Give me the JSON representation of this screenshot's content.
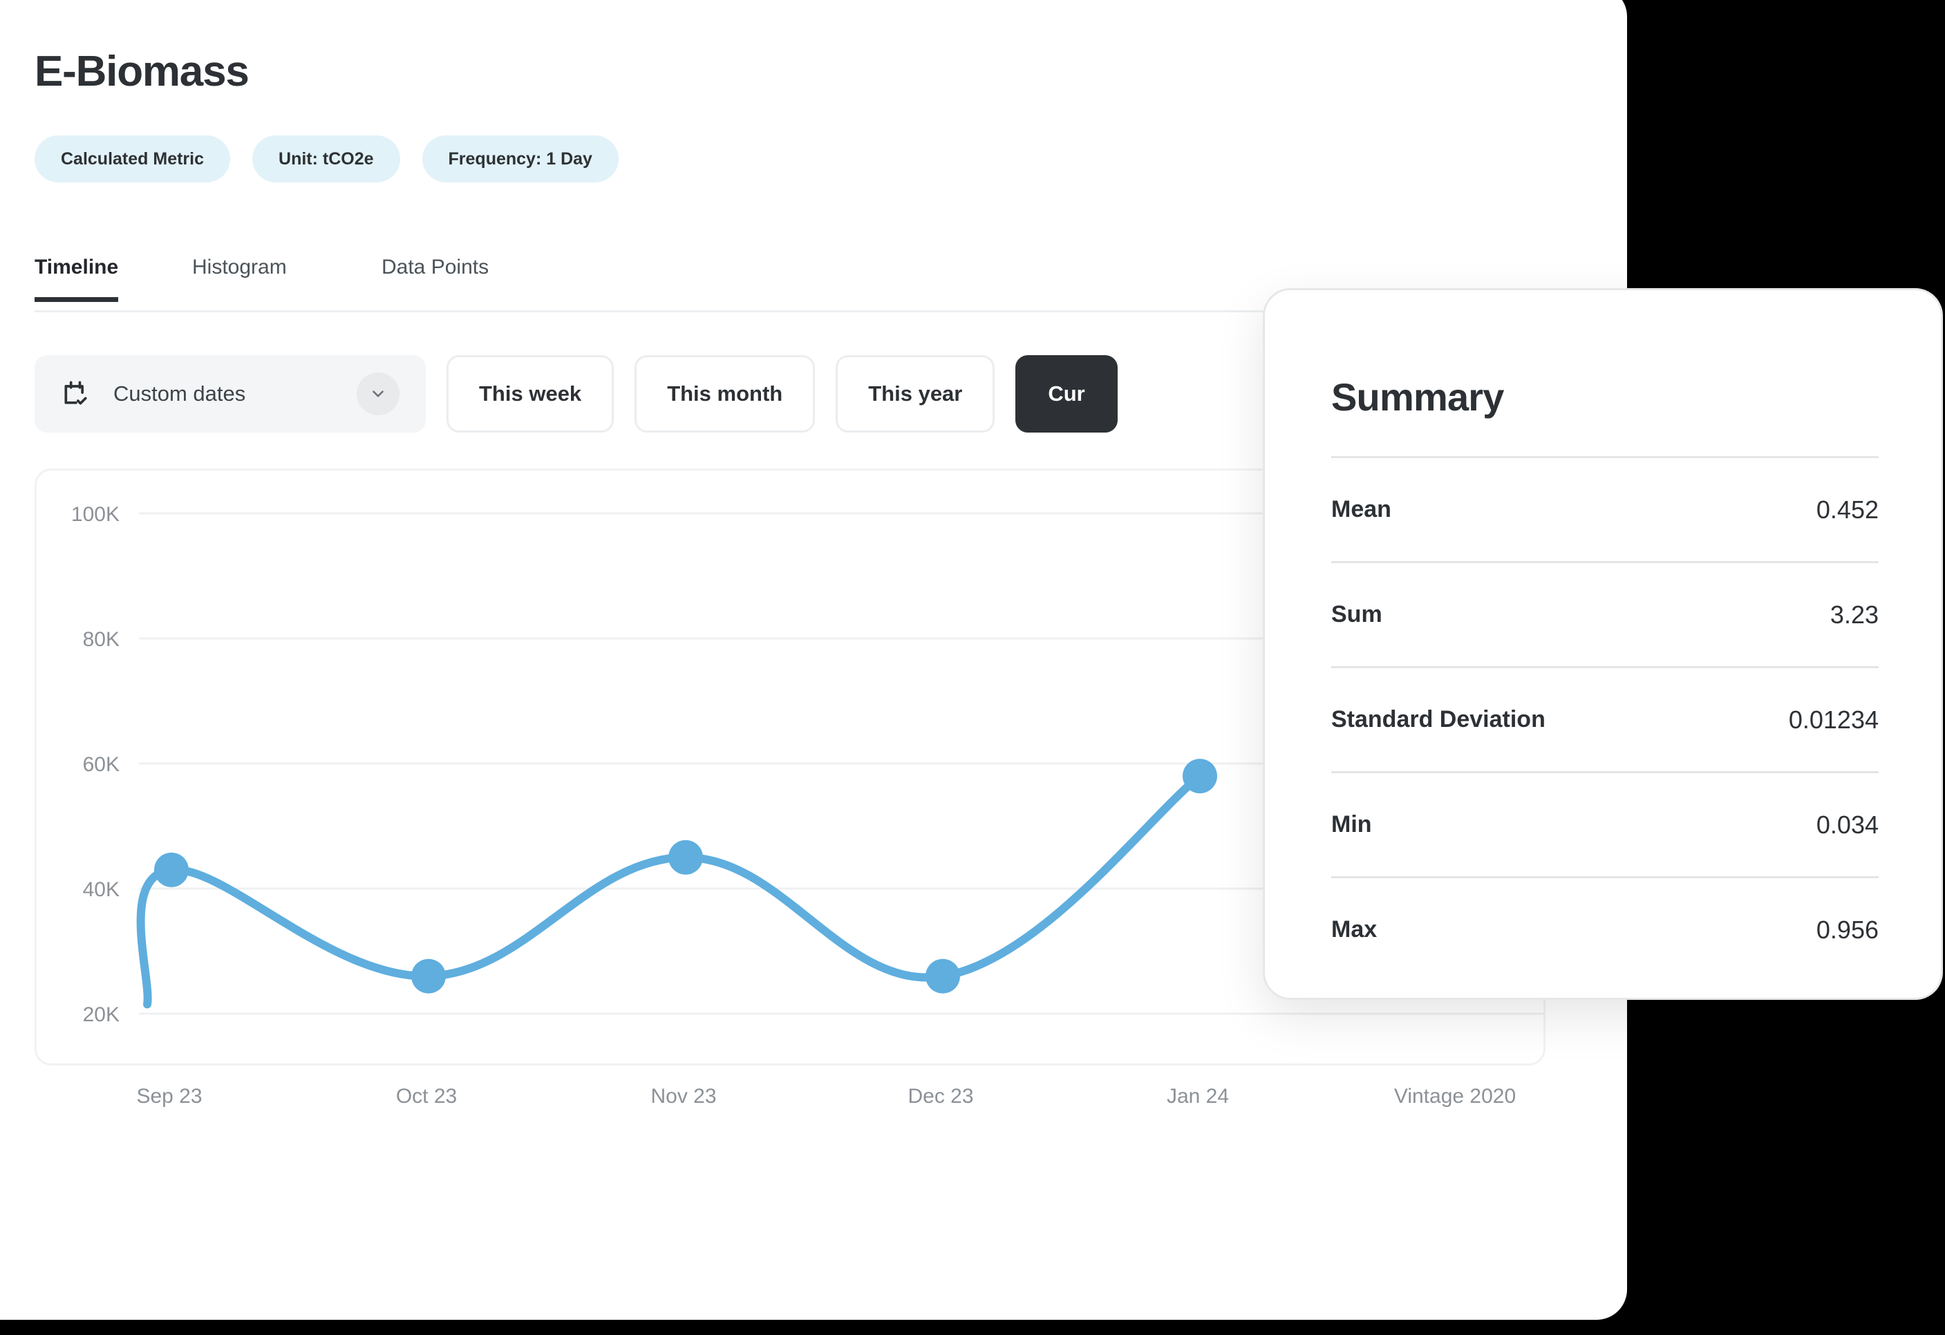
{
  "header": {
    "title": "E-Biomass",
    "badges": [
      {
        "label": "Calculated Metric"
      },
      {
        "label": "Unit: tCO2e"
      },
      {
        "label": "Frequency: 1 Day"
      }
    ]
  },
  "tabs": [
    {
      "label": "Timeline",
      "active": true
    },
    {
      "label": "Histogram",
      "active": false
    },
    {
      "label": "Data Points",
      "active": false
    }
  ],
  "toolbar": {
    "custom_dates_label": "Custom dates",
    "calendar_icon": "calendar-check-icon",
    "chevron_icon": "chevron-down-icon",
    "range_buttons": [
      {
        "label": "This week",
        "active": false
      },
      {
        "label": "This month",
        "active": false
      },
      {
        "label": "This year",
        "active": false
      },
      {
        "label": "Cur",
        "active": true
      }
    ]
  },
  "summary": {
    "title": "Summary",
    "rows": [
      {
        "label": "Mean",
        "value": "0.452"
      },
      {
        "label": "Sum",
        "value": "3.23"
      },
      {
        "label": "Standard Deviation",
        "value": "0.01234"
      },
      {
        "label": "Min",
        "value": "0.034"
      },
      {
        "label": "Max",
        "value": "0.956"
      }
    ]
  },
  "colors": {
    "series": "#5FAEDE",
    "badge_bg": "#E2F2F9",
    "accent_dark": "#2D3135",
    "grid": "#EFF0F2",
    "page_bg": "#000000"
  },
  "chart_data": {
    "type": "line",
    "title": "",
    "xlabel": "",
    "ylabel": "",
    "grid": true,
    "legend": "none",
    "smooth": true,
    "markers": true,
    "ylim": [
      20000,
      100000
    ],
    "ytick_labels": [
      "100K",
      "80K",
      "60K",
      "40K",
      "20K"
    ],
    "ytick_values": [
      100000,
      80000,
      60000,
      40000,
      20000
    ],
    "xtick_labels": [
      "Sep 23",
      "Oct 23",
      "Nov 23",
      "Dec 23",
      "Jan 24",
      "Vintage 2020"
    ],
    "categories": [
      "Sep 23",
      "Oct 23",
      "Nov 23",
      "Dec 23",
      "Jan 24"
    ],
    "values": [
      43000,
      26000,
      45000,
      26000,
      58000
    ],
    "series": [
      {
        "name": "E-Biomass",
        "color": "#5FAEDE",
        "values": [
          43000,
          26000,
          45000,
          26000,
          58000
        ]
      }
    ]
  }
}
